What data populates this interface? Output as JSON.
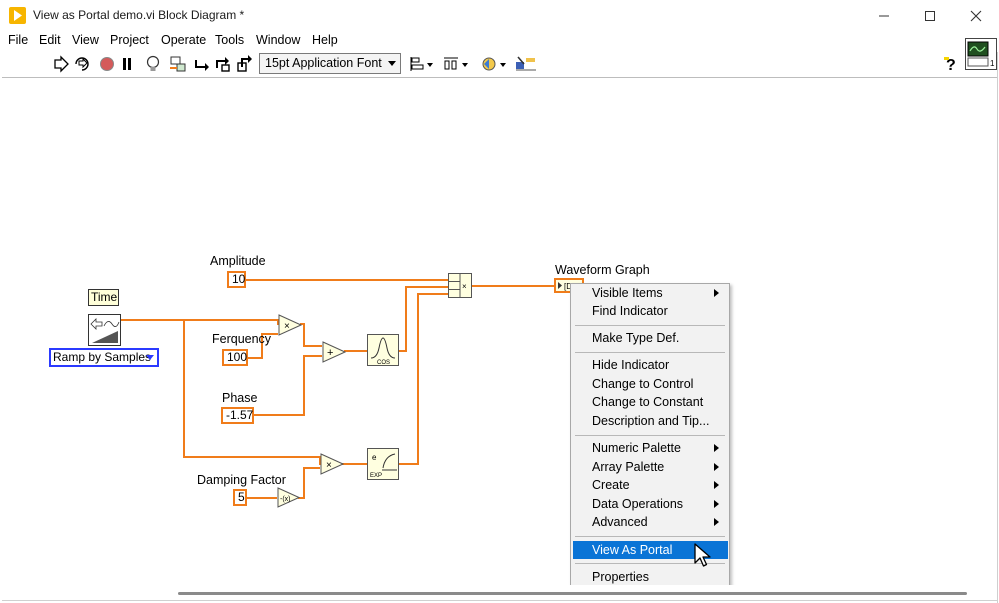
{
  "window": {
    "title": "View as Portal demo.vi Block Diagram *"
  },
  "menubar": {
    "items": [
      "File",
      "Edit",
      "View",
      "Project",
      "Operate",
      "Tools",
      "Window",
      "Help"
    ]
  },
  "toolbar": {
    "font_label": "15pt Application Font"
  },
  "diagram": {
    "time_label": "Time",
    "ramp_label": "Ramp by Samples",
    "amplitude_label": "Amplitude",
    "amplitude_value": "10",
    "frequency_label": "Ferquency",
    "frequency_value": "100",
    "phase_label": "Phase",
    "phase_value": "-1.57",
    "damping_label": "Damping Factor",
    "damping_value": "5",
    "graph_label": "Waveform Graph",
    "cos_label": "COS",
    "exp_label": "EXP"
  },
  "context_menu": {
    "items": [
      {
        "label": "Visible Items",
        "submenu": true
      },
      {
        "label": "Find Indicator"
      },
      {
        "label": "Make Type Def."
      },
      {
        "label": "Hide Indicator"
      },
      {
        "label": "Change to Control"
      },
      {
        "label": "Change to Constant"
      },
      {
        "label": "Description and Tip..."
      },
      {
        "label": "Numeric Palette",
        "submenu": true
      },
      {
        "label": "Array Palette",
        "submenu": true
      },
      {
        "label": "Create",
        "submenu": true
      },
      {
        "label": "Data Operations",
        "submenu": true
      },
      {
        "label": "Advanced",
        "submenu": true
      },
      {
        "label": "View As Portal",
        "highlighted": true
      },
      {
        "label": "Properties"
      }
    ]
  },
  "colors": {
    "wire": "#f07c1a",
    "highlight": "#0a74d6",
    "ramp_border": "#2b3aff"
  }
}
